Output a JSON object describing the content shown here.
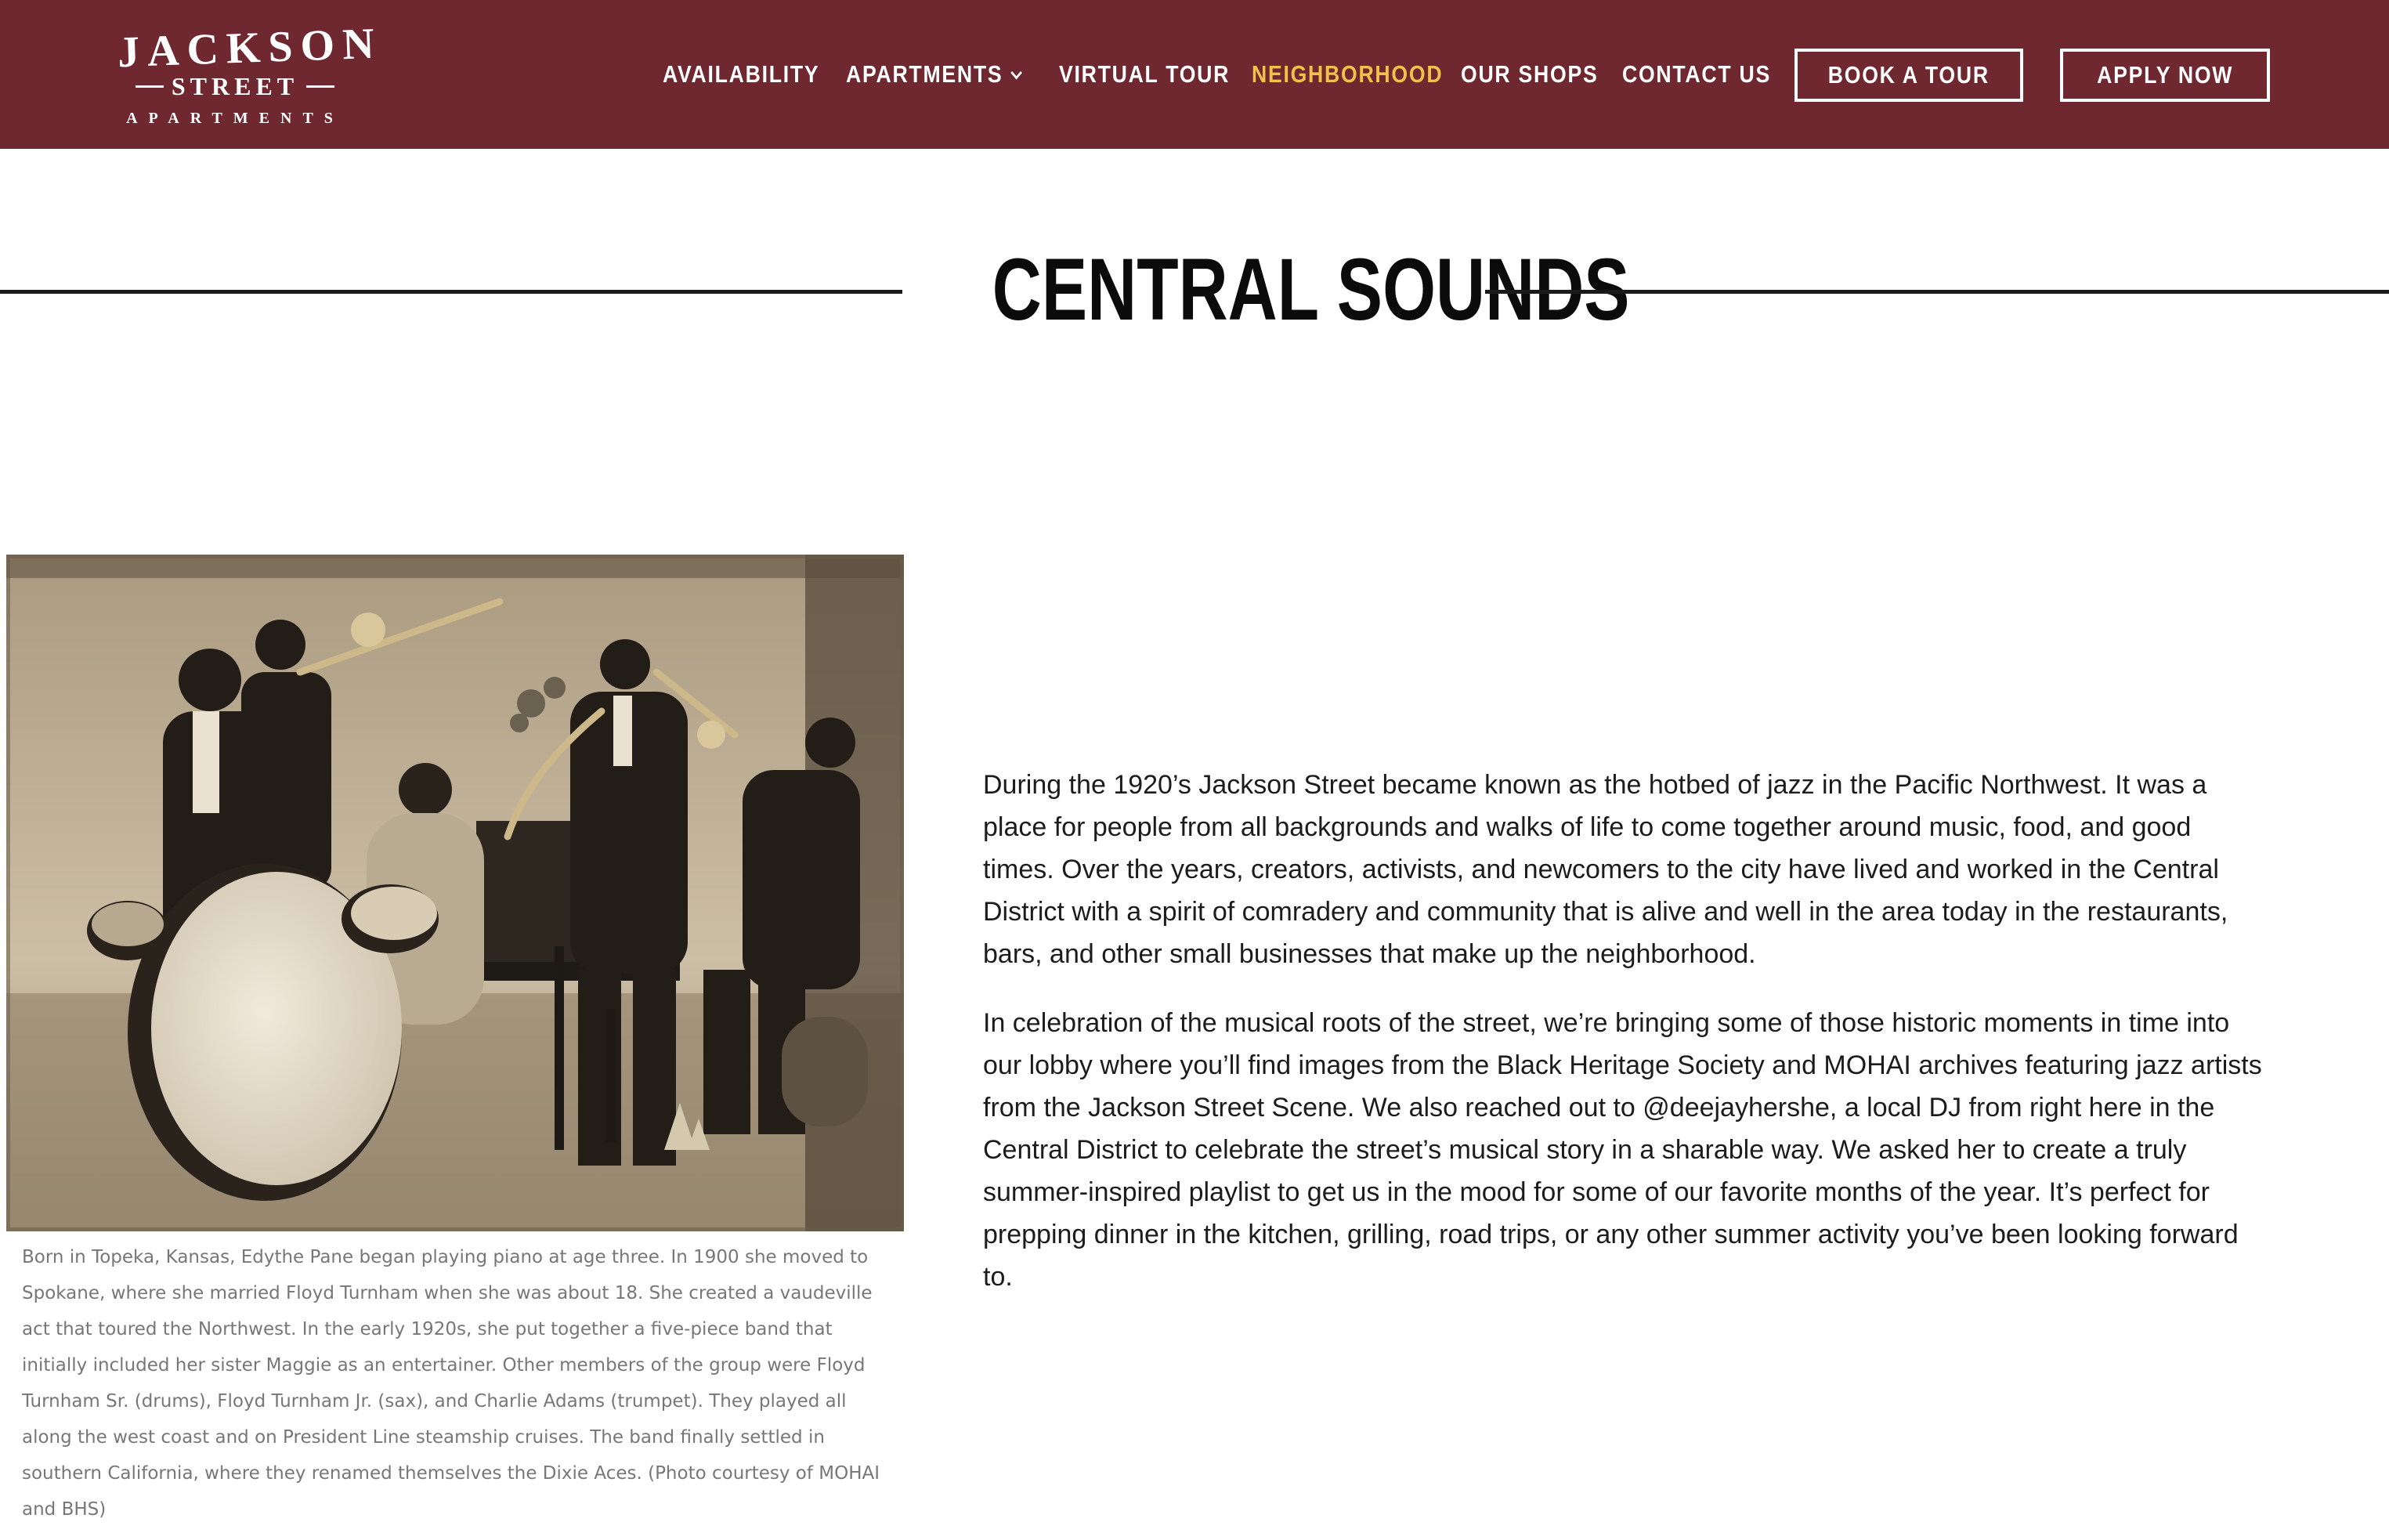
{
  "logo": {
    "line1": "JACKSON",
    "line2": "STREET",
    "line3": "APARTMENTS"
  },
  "nav": {
    "items": [
      {
        "label": "AVAILABILITY"
      },
      {
        "label": "APARTMENTS"
      },
      {
        "label": "VIRTUAL TOUR"
      },
      {
        "label": "NEIGHBORHOOD"
      },
      {
        "label": "OUR SHOPS"
      },
      {
        "label": "CONTACT US"
      }
    ],
    "book_label": "BOOK A TOUR",
    "apply_label": "APPLY NOW",
    "active_item": "NEIGHBORHOOD"
  },
  "colors": {
    "header_bg": "#6f2730",
    "active_nav": "#f3c14a",
    "caption_text": "#777777"
  },
  "icons": {
    "apartments_dropdown": "chevron-down-icon"
  },
  "page": {
    "title": "CENTRAL SOUNDS"
  },
  "photo": {
    "caption": "Born in Topeka, Kansas, Edythe Pane began playing piano at age three. In 1900 she moved to Spokane, where she married Floyd Turnham when she was about 18. She created a vaudeville act that toured the Northwest. In the early 1920s, she put together a five-piece band that initially included her sister Maggie as an entertainer. Other members of the group were Floyd Turnham Sr. (drums), Floyd Turnham Jr. (sax), and Charlie Adams (trumpet). They played all along the west coast and on President Line steamship cruises. The band finally settled in southern California, where they renamed themselves the Dixie Aces. (Photo courtesy of MOHAI and BHS)"
  },
  "content": {
    "paragraph1": "During the 1920’s Jackson Street became known as the hotbed of jazz in the Pacific Northwest. It was a place for people from all backgrounds and walks of life to come together around music, food, and good times. Over the years, creators, activists, and newcomers to the city have lived and worked in the Central District with a spirit of comradery and community that is alive and well in the area today in the restaurants, bars, and other small businesses that make up the neighborhood.",
    "paragraph2": "In celebration of the musical roots of the street, we’re bringing some of those historic moments in time into our lobby where you’ll find images from the Black Heritage Society and MOHAI archives featuring jazz artists from the Jackson Street Scene. We also reached out to @deejayhershe, a local DJ from right here in the Central District to celebrate the street’s musical story in a sharable way. We asked her to create a truly summer-inspired playlist to get us in the mood for some of our favorite months of the year. It’s perfect for prepping dinner in the kitchen, grilling, road trips, or any other summer activity you’ve been looking forward to."
  }
}
